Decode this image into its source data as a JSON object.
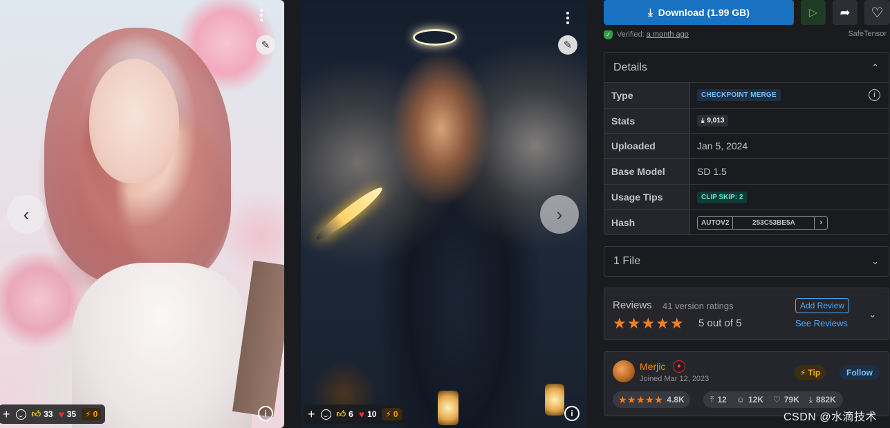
{
  "gallery": {
    "cards": [
      {
        "reactions": {
          "like": "33",
          "heart": "35",
          "buzz": "0"
        }
      },
      {
        "reactions": {
          "like": "6",
          "heart": "10",
          "buzz": "0"
        }
      }
    ],
    "icons": {
      "prev": "chevron-left-icon",
      "next": "chevron-right-icon",
      "remix": "brush-icon",
      "menu": "dots-vertical-icon",
      "info": "info-icon"
    }
  },
  "actions": {
    "download_label": "Download (1.99 GB)",
    "verified_label": "Verified:",
    "verified_time": "a month ago",
    "file_format": "SafeTensor"
  },
  "details": {
    "title": "Details",
    "rows": {
      "type_label": "Type",
      "type_value": "CHECKPOINT MERGE",
      "stats_label": "Stats",
      "stats_downloads": "9,013",
      "uploaded_label": "Uploaded",
      "uploaded_value": "Jan 5, 2024",
      "base_model_label": "Base Model",
      "base_model_value": "SD 1.5",
      "usage_tips_label": "Usage Tips",
      "usage_tips_value": "CLIP SKIP: 2",
      "hash_label": "Hash",
      "hash_type": "AUTOV2",
      "hash_value": "253C53BE5A"
    }
  },
  "files": {
    "title": "1 File"
  },
  "reviews": {
    "title": "Reviews",
    "count": "41 version ratings",
    "stars": "★★★★★",
    "score": "5 out of 5",
    "add_label": "Add Review",
    "see_label": "See Reviews"
  },
  "creator": {
    "name": "Merjic",
    "joined": "Joined Mar 12, 2023",
    "tip_label": "Tip",
    "follow_label": "Follow",
    "rating_stars": "★★★★★",
    "rating_count": "4.8K",
    "uploads": "12",
    "followers": "12K",
    "favorites": "79K",
    "downloads": "882K"
  },
  "watermark": "CSDN @水滴技术",
  "colors": {
    "accent": "#1971c2",
    "link": "#4dabf7",
    "star": "#fd7e14",
    "creator_name": "#f08c00",
    "background": "#1a1b1e"
  }
}
